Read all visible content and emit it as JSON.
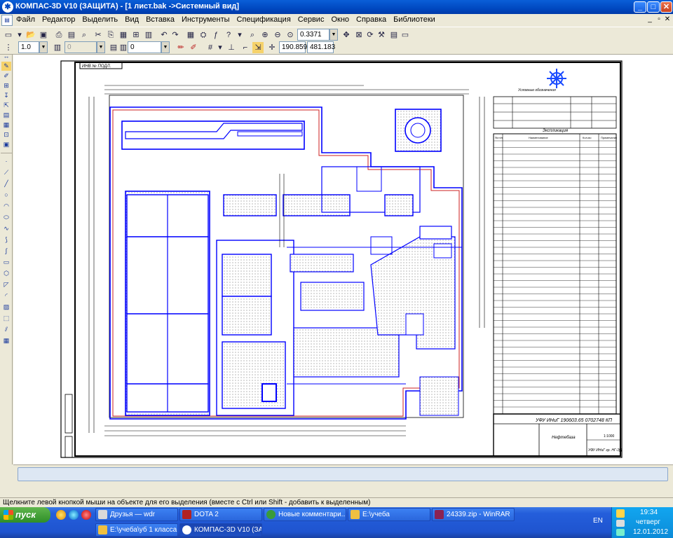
{
  "window": {
    "title": "КОМПАС-3D V10 (ЗАЩИТА) - [1 лист.bak ->Системный вид]",
    "controls": [
      "_",
      "□",
      "✕"
    ]
  },
  "menu": [
    "Файл",
    "Редактор",
    "Выделить",
    "Вид",
    "Вставка",
    "Инструменты",
    "Спецификация",
    "Сервис",
    "Окно",
    "Справка",
    "Библиотеки"
  ],
  "toolbar1": {
    "zoom_value": "0.3371"
  },
  "toolbar2": {
    "style_value": "1.0",
    "layer_value": "0",
    "layer2_value": "0",
    "coord_x": "190.859",
    "coord_y": "481.183"
  },
  "drawing": {
    "frame_label": "ИНВ № ПОДЛ.",
    "table_header": "Экспликация",
    "legend_header": "Условные обозначения",
    "col_num": "№ п/п",
    "col_name": "Наименование",
    "col_count": "Кол-во",
    "col_note": "Примечание",
    "stamp_code": "УФУ ИНиГ 190603.65 0702748 КП",
    "stamp_title": "Нефтебаза",
    "stamp_scale": "1:1000",
    "stamp_org": "УФУ ИНиГ гр. НГ-ЭД"
  },
  "status": {
    "hint": "Щелкните левой кнопкой мыши на объекте для его выделения (вместе с Ctrl или Shift - добавить к выделенным)"
  },
  "taskbar": {
    "start_label": "пуск",
    "row1": [
      {
        "label": "Друзья — wdr",
        "color": "#d9d9d9"
      },
      {
        "label": "DOTA 2",
        "color": "#b22222"
      },
      {
        "label": "Новые комментари...",
        "color": "#3a9b3a"
      },
      {
        "label": "E:\\учеба",
        "color": "#f0c040"
      },
      {
        "label": "24339.zip - WinRAR",
        "color": "#8b2252"
      }
    ],
    "row2": [
      {
        "label": "E:\\учеба\\уб 1 класса",
        "color": "#f0c040"
      },
      {
        "label": "КОМПАС-3D V10 (ЗА...",
        "color": "#ffffff"
      }
    ],
    "lang": "EN",
    "time": "19:34",
    "day": "четверг",
    "date": "12.01.2012"
  }
}
